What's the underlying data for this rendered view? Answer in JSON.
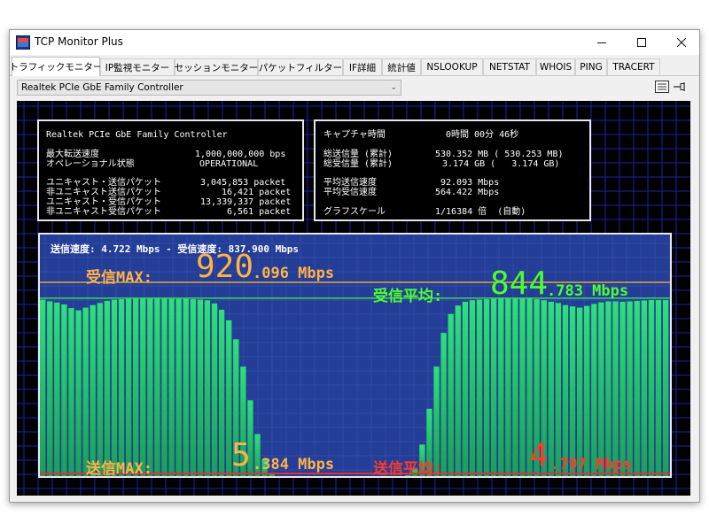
{
  "window": {
    "title": "TCP Monitor Plus"
  },
  "tabs": [
    "トラフィックモニター",
    "IP監視モニター",
    "セッションモニター",
    "パケットフィルター",
    "IF詳細",
    "統計値",
    "NSLOOKUP",
    "NETSTAT",
    "WHOIS",
    "PING",
    "TRACERT"
  ],
  "adapter_select": {
    "value": "Realtek PCIe GbE Family Controller"
  },
  "left_panel": {
    "adapter_name": "Realtek PCIe GbE Family Controller",
    "max_speed_label": "最大転送速度",
    "max_speed_value": "1,000,000,000 bps",
    "op_state_label": "オペレーショナル状態",
    "op_state_value": "OPERATIONAL",
    "unicast_sent_label": "ユニキャスト・送信パケット",
    "unicast_sent_value": "3,045,853 packet",
    "nonunicast_sent_label": "非ユニキャスト送信パケット",
    "nonunicast_sent_value": "16,421 packet",
    "unicast_recv_label": "ユニキャスト・受信パケット",
    "unicast_recv_value": "13,339,337 packet",
    "nonunicast_recv_label": "非ユニキャスト受信パケット",
    "nonunicast_recv_value": "6,561 packet"
  },
  "right_panel": {
    "capture_time_label": "キャプチャ時間",
    "capture_time_value": "0時間 00分 46秒",
    "total_sent_label": "総送信量 (累計)",
    "total_sent_value": "530.352 MB ( 530.253 MB)",
    "total_recv_label": "総受信量 (累計)",
    "total_recv_value": "3.174 GB (   3.174 GB)",
    "avg_send_label": "平均送信速度",
    "avg_send_value": "92.093 Mbps",
    "avg_recv_label": "平均受信速度",
    "avg_recv_value": "564.422 Mbps",
    "graph_scale_label": "グラフスケール",
    "graph_scale_value": "1/16384 倍  (自動)"
  },
  "graph": {
    "current_line": "送信速度:  4.722 Mbps  -  受信速度: 837.900 Mbps",
    "recv_max_label": "受信MAX:",
    "recv_max_int": "920",
    "recv_max_dec": ".096 Mbps",
    "recv_avg_label": "受信平均:",
    "recv_avg_int": "844",
    "recv_avg_dec": ".783 Mbps",
    "send_max_label": "送信MAX:",
    "send_max_int": "5",
    "send_max_dec": ".384 Mbps",
    "send_avg_label": "送信平均:",
    "send_avg_int": "4",
    "send_avg_dec": ".797 Mbps",
    "recv_series_mbps": [
      838,
      830,
      824,
      815,
      798,
      787,
      800,
      812,
      822,
      832,
      838,
      840,
      842,
      843,
      844,
      844,
      843,
      843,
      842,
      842,
      842,
      840,
      838,
      835,
      820,
      790,
      740,
      650,
      520,
      360,
      200,
      80,
      15,
      0,
      0,
      0,
      0,
      0,
      0,
      0,
      0,
      0,
      0,
      0,
      0,
      0,
      0,
      0,
      0,
      0,
      0,
      5,
      40,
      150,
      320,
      520,
      680,
      770,
      810,
      828,
      835,
      838,
      840,
      842,
      843,
      844,
      844,
      844,
      843,
      840,
      835,
      828,
      822,
      812,
      806,
      800,
      808,
      818,
      825,
      830,
      830,
      828,
      830,
      832,
      834,
      836,
      836,
      836
    ]
  },
  "colors": {
    "graph_bg": "#243d96",
    "grid": "#1a24a8",
    "recv_fill": "#27d06a",
    "recv_max_line": "#e3a53a",
    "recv_avg_line": "#3bd25a",
    "send_line": "#e03030",
    "recv_max_text": "#ffb347",
    "recv_avg_text": "#4dff2e",
    "send_max_text": "#ffb347",
    "send_avg_text": "#ff3a2a"
  }
}
